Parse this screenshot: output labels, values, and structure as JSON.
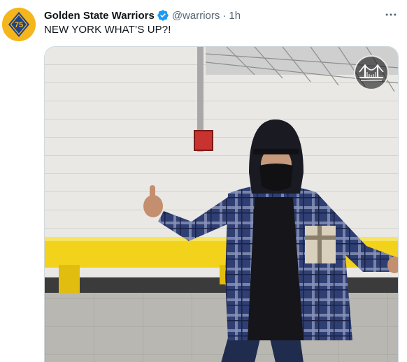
{
  "tweet": {
    "display_name": "Golden State Warriors",
    "handle": "@warriors",
    "separator": "·",
    "time": "1h",
    "text": "NEW YORK WHAT’S UP?!"
  },
  "icons": {
    "avatar": "warriors-75th-logo",
    "verified": "verified-badge-icon",
    "more": "more-horizontal-icon",
    "watermark": "warriors-bridge-logo"
  },
  "colors": {
    "verified_blue": "#1d9bf0",
    "secondary_text": "#536471",
    "primary_text": "#0f1419",
    "avatar_gold": "#f5b51c",
    "avatar_navy": "#1d428a"
  }
}
